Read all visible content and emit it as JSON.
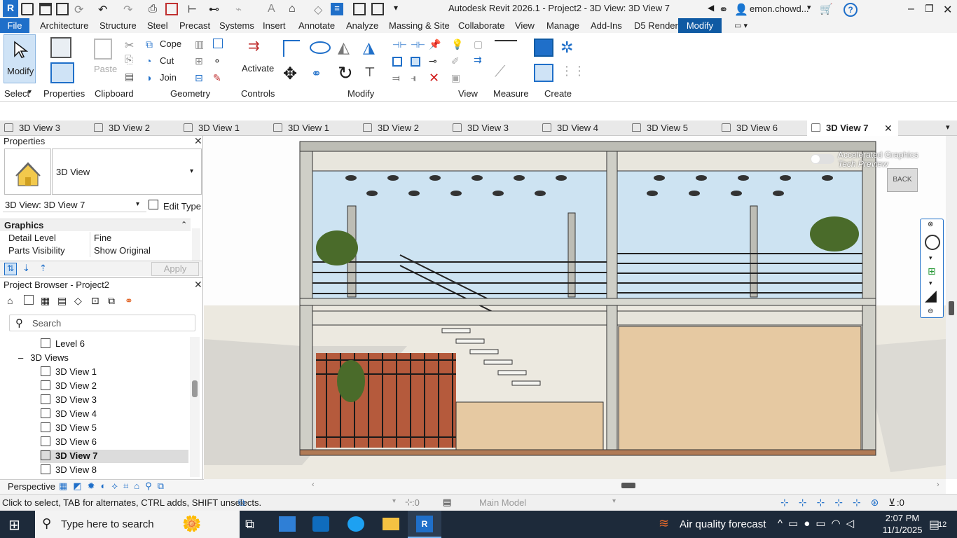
{
  "window": {
    "app_title": "Autodesk Revit 2026.1 - Project2 - 3D View: 3D View 7",
    "user": "emon.chowd..."
  },
  "ribbon_tabs": [
    "File",
    "Architecture",
    "Structure",
    "Steel",
    "Precast",
    "Systems",
    "Insert",
    "Annotate",
    "Analyze",
    "Massing & Site",
    "Collaborate",
    "View",
    "Manage",
    "Add-Ins",
    "D5 Render",
    "Modify"
  ],
  "ribbon": {
    "modify_tool": "Modify",
    "panels": {
      "select": "Select",
      "properties": "Properties",
      "clipboard": "Clipboard",
      "geometry": "Geometry",
      "controls": "Controls",
      "modify": "Modify",
      "view": "View",
      "measure": "Measure",
      "create": "Create"
    },
    "paste": "Paste",
    "cope": "Cope",
    "cut": "Cut",
    "join": "Join",
    "activate": "Activate"
  },
  "view_tabs": [
    "3D View 3",
    "3D View 2",
    "3D View 1",
    "3D View 1",
    "3D View 2",
    "3D View 3",
    "3D View 4",
    "3D View 5",
    "3D View 6",
    "3D View 7"
  ],
  "properties": {
    "title": "Properties",
    "type_name": "3D View",
    "instance": "3D View: 3D View 7",
    "edit_type": "Edit Type",
    "section": "Graphics",
    "rows": [
      {
        "label": "Detail Level",
        "value": "Fine"
      },
      {
        "label": "Parts Visibility",
        "value": "Show Original"
      }
    ],
    "apply": "Apply"
  },
  "browser": {
    "title": "Project Browser - Project2",
    "search_placeholder": "Search",
    "level_item": "Level 6",
    "group": "3D Views",
    "views": [
      "3D View 1",
      "3D View 2",
      "3D View 3",
      "3D View 4",
      "3D View 5",
      "3D View 6",
      "3D View 7",
      "3D View 8"
    ],
    "selected": "3D View 7"
  },
  "viewport": {
    "accel_graphics": "Accelerated Graphics",
    "tech_preview": "Tech Preview",
    "viewcube_label": "BACK"
  },
  "view_control": {
    "mode": "Perspective"
  },
  "status": {
    "hint": "Click to select, TAB for alternates, CTRL adds, SHIFT unselects.",
    "select_count": ":0",
    "model": "Main Model",
    "filter_count": ":0"
  },
  "taskbar": {
    "search_placeholder": "Type here to search",
    "weather": "Air quality forecast",
    "time": "2:07 PM",
    "date": "11/1/2025",
    "notifications": "12"
  },
  "colors": {
    "file_tab": "#1f6fc9",
    "modify_tab": "#0f5aa3",
    "sky": "#cde3f2",
    "ground": "#ece9e0",
    "wood": "#e6c9a2",
    "taskbar": "#1d2a3a"
  }
}
